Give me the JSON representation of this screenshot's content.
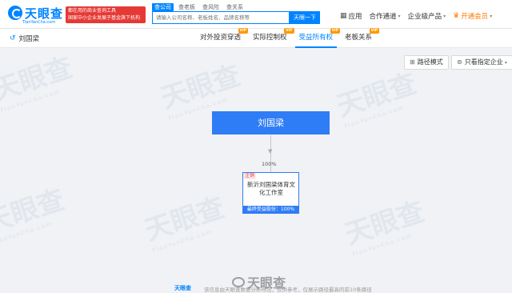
{
  "brand": {
    "logo_text": "天眼查",
    "logo_sub": "TianYanCha.com",
    "slogan_line1": "都在用的商业查询工具",
    "slogan_line2": "国家中小企业发展子基金旗下机构"
  },
  "search": {
    "tabs": [
      "查公司",
      "查老板",
      "查风险",
      "查关系"
    ],
    "active_tab": "查公司",
    "placeholder": "请输入公司名称、老板姓名、品牌名称等",
    "button_label": "天眼一下"
  },
  "top_nav": {
    "app": "应用",
    "partner": "合作通道",
    "enterprise": "企业级产品",
    "vip": "开通会员"
  },
  "subbar": {
    "back_label": "刘国梁",
    "tabs": [
      {
        "label": "对外投资穿透",
        "badge": "VIP",
        "active": false
      },
      {
        "label": "实际控制权",
        "badge": "VIP",
        "active": false
      },
      {
        "label": "受益所有权",
        "badge": "VIP",
        "active": true
      },
      {
        "label": "老板关系",
        "badge": "VIP",
        "active": false
      }
    ]
  },
  "tools": {
    "path_mode": "路径模式",
    "filter": "只看指定企业"
  },
  "graph": {
    "person": "刘国梁",
    "edge_percent": "100%",
    "company_status": "注销",
    "company_name": "新沂刘国梁体育文化工作室",
    "final_stake": "最终受益股份：100%"
  },
  "watermark": {
    "text": "天眼查",
    "sub": "TianYanCha.com"
  },
  "footer": {
    "logo": "天眼查",
    "text": "该信息由天眼查数据分析得出，仅供参考，仅展示路径最高的前10条路径",
    "weibo": "天眼查"
  }
}
